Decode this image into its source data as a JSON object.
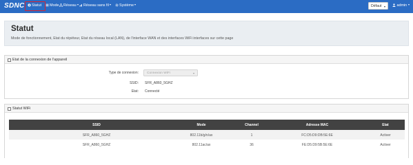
{
  "navbar": {
    "brand": "SDNC",
    "items": [
      {
        "label": "Statut",
        "icon": "info-circle-icon",
        "dropdown": false
      },
      {
        "label": "Mode",
        "icon": "list-icon",
        "dropdown": false
      },
      {
        "label": "Réseau",
        "icon": "network-icon",
        "dropdown": true
      },
      {
        "label": "Réseau sans fil",
        "icon": "wifi-icon",
        "dropdown": true
      },
      {
        "label": "Système",
        "icon": "gear-icon",
        "dropdown": true
      }
    ],
    "language": "Défaut",
    "user": "admin"
  },
  "header": {
    "title": "Statut",
    "description": "Mode de fonctionnement, Etat du répéteur, Etat du réseau local (LAN), de l'interface WAN et des interfaces WiFi interfaces sur cette page"
  },
  "connection": {
    "section_title": "Etat de la connexion de l'appareil",
    "type_label": "Type de connexion:",
    "type_value": "Connexion WiFi",
    "ssid_label": "SSID:",
    "ssid_value": "SFR_A860_5GHZ",
    "state_label": "Etat:",
    "state_value": "Connecté"
  },
  "wifi_status": {
    "section_title": "Statut WiFi",
    "columns": [
      "SSID",
      "Mode",
      "Channel",
      "Adresse MAC",
      "Etat"
    ],
    "rows": [
      [
        "SFR_A860_5GHZ",
        "802.11b/g/n/ax",
        "1",
        "FC:D5:D9:DB:5E:6E",
        "Activer"
      ],
      [
        "SFR_A860_5GHZ",
        "802.11ac/ax",
        "36",
        "FE:D5:D9:5B:5E:6E",
        "Activer"
      ]
    ]
  },
  "colors": {
    "navbar": "#2b6cc4",
    "highlight": "#d9232e",
    "table_header": "#424242"
  }
}
